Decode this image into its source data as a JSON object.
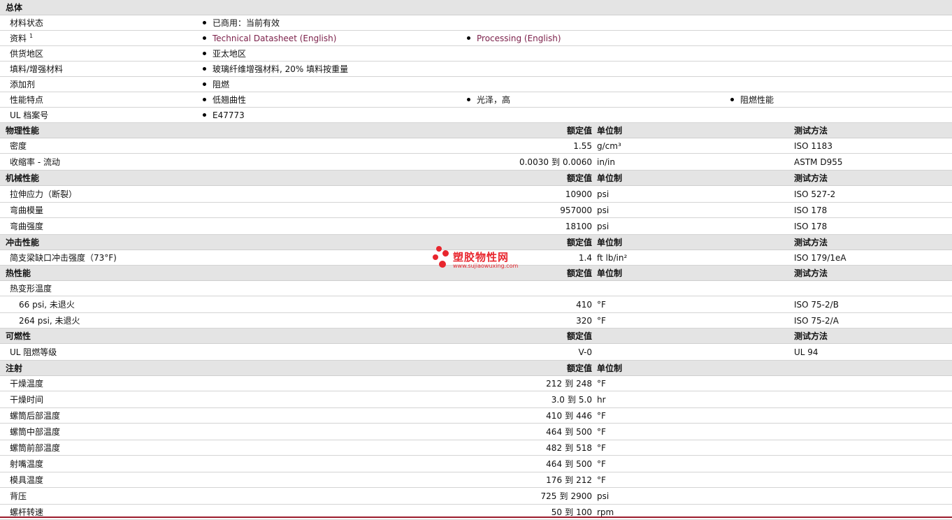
{
  "general": {
    "section_title": "总体",
    "rows": [
      {
        "label": "材料状态",
        "values": [
          "已商用：当前有效"
        ]
      },
      {
        "label": "资料",
        "sup": "1",
        "links": [
          "Technical Datasheet (English)",
          "Processing (English)"
        ]
      },
      {
        "label": "供货地区",
        "values": [
          "亚太地区"
        ]
      },
      {
        "label": "填料/增强材料",
        "values": [
          "玻璃纤维增强材料, 20% 填料按重量"
        ]
      },
      {
        "label": "添加剂",
        "values": [
          "阻燃"
        ]
      },
      {
        "label": "性能特点",
        "values": [
          "低翘曲性",
          "光泽，高",
          "阻燃性能"
        ]
      },
      {
        "label": "UL 档案号",
        "values": [
          "E47773"
        ]
      }
    ]
  },
  "headers": {
    "nominal": "额定值",
    "unit": "单位制",
    "test": "测试方法"
  },
  "range_word": "到",
  "physical": {
    "section_title": "物理性能",
    "rows": [
      {
        "label": "密度",
        "nominal": "1.55",
        "unit": "g/cm³",
        "test": "ISO 1183"
      },
      {
        "label": "收缩率  - 流动",
        "from": "0.0030",
        "to": "0.0060",
        "unit": "in/in",
        "test": "ASTM D955"
      }
    ]
  },
  "mechanical": {
    "section_title": "机械性能",
    "rows": [
      {
        "label": "拉伸应力（断裂）",
        "nominal": "10900",
        "unit": "psi",
        "test": "ISO 527-2"
      },
      {
        "label": "弯曲模量",
        "nominal": "957000",
        "unit": "psi",
        "test": "ISO 178"
      },
      {
        "label": "弯曲强度",
        "nominal": "18100",
        "unit": "psi",
        "test": "ISO 178"
      }
    ]
  },
  "impact": {
    "section_title": "冲击性能",
    "rows": [
      {
        "label": "简支梁缺口冲击强度（73°F)",
        "nominal": "1.4",
        "unit": "ft lb/in²",
        "test": "ISO 179/1eA"
      }
    ]
  },
  "thermal": {
    "section_title": "热性能",
    "group_label": "热变形温度",
    "rows": [
      {
        "label": "66 psi, 未退火",
        "nominal": "410",
        "unit": "°F",
        "test": "ISO 75-2/B"
      },
      {
        "label": "264 psi, 未退火",
        "nominal": "320",
        "unit": "°F",
        "test": "ISO 75-2/A"
      }
    ]
  },
  "flammability": {
    "section_title": "可燃性",
    "rows": [
      {
        "label": "UL 阻燃等级",
        "nominal": "V-0",
        "unit": "",
        "test": "UL 94"
      }
    ]
  },
  "injection": {
    "section_title": "注射",
    "rows": [
      {
        "label": "干燥温度",
        "from": "212",
        "to": "248",
        "unit": "°F"
      },
      {
        "label": "干燥时间",
        "from": "3.0",
        "to": "5.0",
        "unit": "hr"
      },
      {
        "label": "螺筒后部温度",
        "from": "410",
        "to": "446",
        "unit": "°F"
      },
      {
        "label": "螺筒中部温度",
        "from": "464",
        "to": "500",
        "unit": "°F"
      },
      {
        "label": "螺筒前部温度",
        "from": "482",
        "to": "518",
        "unit": "°F"
      },
      {
        "label": "射嘴温度",
        "from": "464",
        "to": "500",
        "unit": "°F"
      },
      {
        "label": "模具温度",
        "from": "176",
        "to": "212",
        "unit": "°F"
      },
      {
        "label": "背压",
        "from": "725",
        "to": "2900",
        "unit": "psi"
      },
      {
        "label": "螺杆转速",
        "from": "50",
        "to": "100",
        "unit": "rpm"
      }
    ]
  },
  "watermark": {
    "title": "塑胶物性网",
    "url": "www.sujiaowuxing.com"
  },
  "colors": {
    "link": "#7b1f49",
    "section_bg": "#e4e4e4",
    "watermark": "#e8262e",
    "bottom_rule": "#9b1b2c"
  }
}
